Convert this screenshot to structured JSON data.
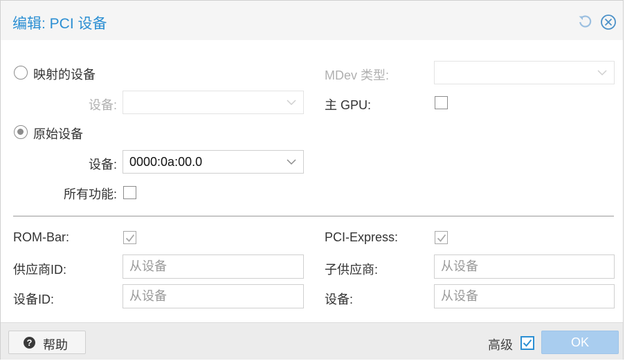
{
  "dialog": {
    "title": "编辑: PCI 设备",
    "tools": {
      "reset_icon": "reset-icon",
      "close_icon": "close-icon"
    }
  },
  "form": {
    "mapped_device_radio": {
      "label": "映射的设备",
      "checked": false
    },
    "mapped_device_select": {
      "label": "设备:",
      "value": "",
      "disabled": true
    },
    "raw_device_radio": {
      "label": "原始设备",
      "checked": true
    },
    "raw_device_select": {
      "label": "设备:",
      "value": "0000:0a:00.0"
    },
    "all_functions": {
      "label": "所有功能:",
      "checked": false
    },
    "mdev_type": {
      "label": "MDev 类型:",
      "value": "",
      "disabled": true
    },
    "primary_gpu": {
      "label": "主 GPU:",
      "checked": false
    },
    "rom_bar": {
      "label": "ROM-Bar:",
      "checked": true,
      "disabled": true
    },
    "pci_express": {
      "label": "PCI-Express:",
      "checked": true,
      "disabled": true
    },
    "vendor_id": {
      "label": "供应商ID:",
      "placeholder": "从设备"
    },
    "device_id": {
      "label": "设备ID:",
      "placeholder": "从设备"
    },
    "sub_vendor": {
      "label": "子供应商:",
      "placeholder": "从设备"
    },
    "sub_device": {
      "label": "设备:",
      "placeholder": "从设备"
    }
  },
  "footer": {
    "help_label": "帮助",
    "advanced_label": "高级",
    "advanced_checked": true,
    "ok_label": "OK"
  },
  "colors": {
    "accent": "#2c8fd3",
    "ok_button": "#a9cdef",
    "header_bg": "#f5f5f5",
    "footer_bg": "#ececec"
  }
}
